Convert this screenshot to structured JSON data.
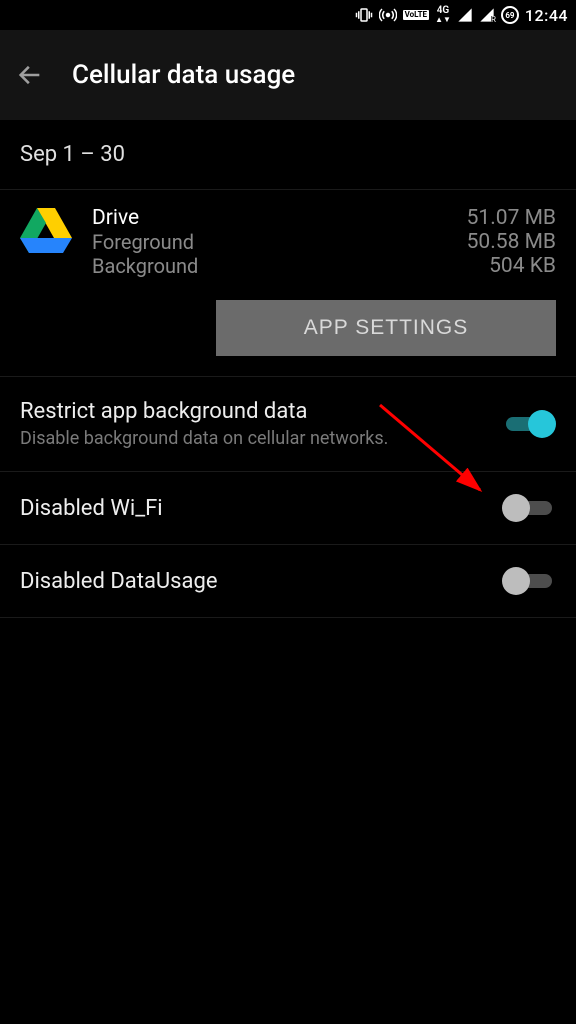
{
  "status_bar": {
    "volte": "VoLTE",
    "fourg": "4G",
    "battery": "69",
    "time": "12:44"
  },
  "header": {
    "title": "Cellular data usage"
  },
  "date_range": "Sep 1 – 30",
  "app": {
    "name": "Drive",
    "total": "51.07 MB",
    "foreground_label": "Foreground",
    "foreground_value": "50.58 MB",
    "background_label": "Background",
    "background_value": "504 KB",
    "settings_button": "APP SETTINGS"
  },
  "settings": [
    {
      "title": "Restrict app background data",
      "subtitle": "Disable background data on cellular networks.",
      "on": true
    },
    {
      "title": "Disabled Wi_Fi",
      "subtitle": "",
      "on": false
    },
    {
      "title": "Disabled DataUsage",
      "subtitle": "",
      "on": false
    }
  ]
}
